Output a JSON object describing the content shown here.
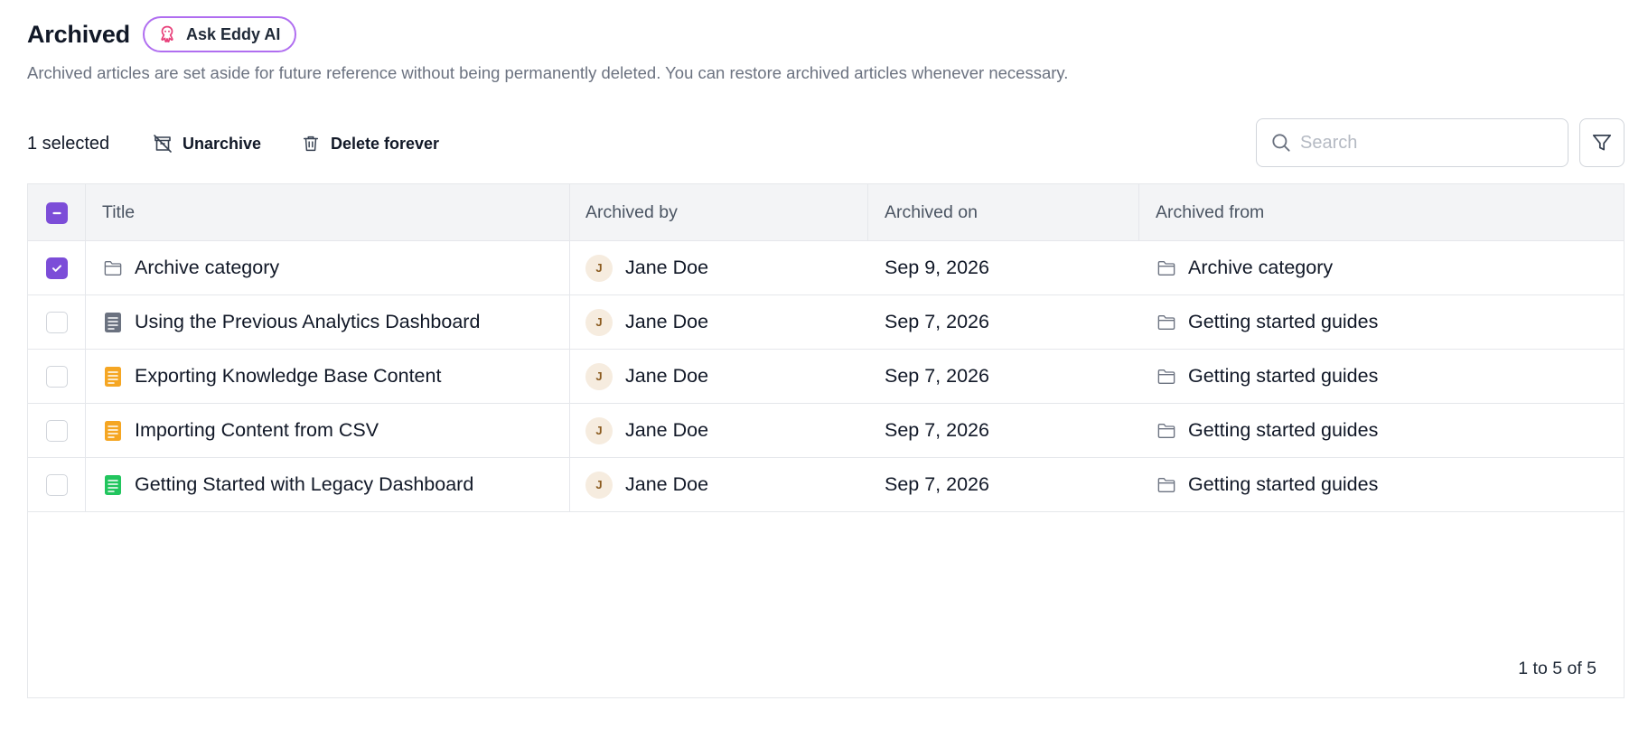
{
  "page": {
    "title": "Archived",
    "ai_button_label": "Ask Eddy AI",
    "subtitle": "Archived articles are set aside for future reference without being permanently deleted. You can restore archived articles whenever necessary."
  },
  "toolbar": {
    "selected_count": "1 selected",
    "unarchive_label": "Unarchive",
    "delete_label": "Delete forever",
    "search_placeholder": "Search",
    "search_value": ""
  },
  "table": {
    "columns": [
      "Title",
      "Archived by",
      "Archived on",
      "Archived from"
    ],
    "rows": [
      {
        "checked": true,
        "type": "folder-icon",
        "title": "Archive category",
        "avatar": "J",
        "archived_by": "Jane Doe",
        "archived_on": "Sep 9, 2026",
        "archived_from": "Archive category"
      },
      {
        "checked": false,
        "type": "article-icon",
        "icon_color": "#6b7280",
        "title": "Using the Previous Analytics Dashboard",
        "avatar": "J",
        "archived_by": "Jane Doe",
        "archived_on": "Sep 7, 2026",
        "archived_from": "Getting started guides"
      },
      {
        "checked": false,
        "type": "article-icon",
        "icon_color": "#f5a623",
        "title": "Exporting Knowledge Base Content",
        "avatar": "J",
        "archived_by": "Jane Doe",
        "archived_on": "Sep 7, 2026",
        "archived_from": "Getting started guides"
      },
      {
        "checked": false,
        "type": "article-icon",
        "icon_color": "#f5a623",
        "title": "Importing Content from CSV",
        "avatar": "J",
        "archived_by": "Jane Doe",
        "archived_on": "Sep 7, 2026",
        "archived_from": "Getting started guides"
      },
      {
        "checked": false,
        "type": "article-icon",
        "icon_color": "#22c55e",
        "title": "Getting Started with Legacy Dashboard",
        "avatar": "J",
        "archived_by": "Jane Doe",
        "archived_on": "Sep 7, 2026",
        "archived_from": "Getting started guides"
      }
    ]
  },
  "pagination": {
    "label": "1 to 5 of 5"
  },
  "colors": {
    "accent": "#7c4dd8",
    "ai_border": "#b06ef0",
    "ai_icon": "#e8407a",
    "header_bg": "#f3f4f6"
  }
}
